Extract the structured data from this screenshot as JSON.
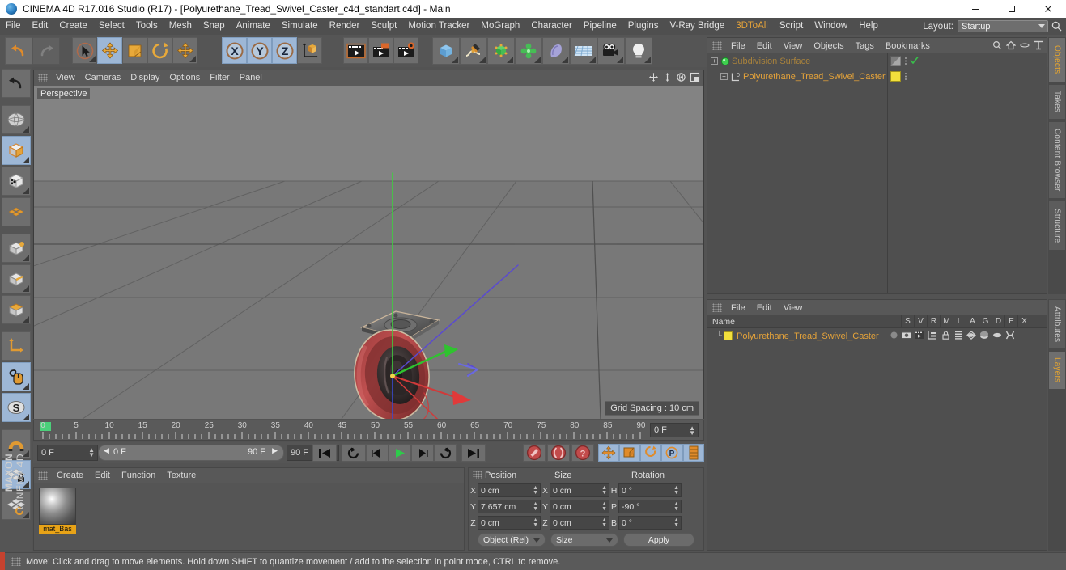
{
  "window": {
    "title": "CINEMA 4D R17.016 Studio (R17) - [Polyurethane_Tread_Swivel_Caster_c4d_standart.c4d] - Main",
    "minimize": "–",
    "maximize": "❐",
    "close": "✕"
  },
  "menubar": {
    "items": [
      "File",
      "Edit",
      "Create",
      "Select",
      "Tools",
      "Mesh",
      "Snap",
      "Animate",
      "Simulate",
      "Render",
      "Sculpt",
      "Motion Tracker",
      "MoGraph",
      "Character",
      "Pipeline",
      "Plugins",
      "V-Ray Bridge",
      "3DToAll",
      "Script",
      "Window",
      "Help"
    ],
    "layout_label": "Layout:",
    "layout_value": "Startup"
  },
  "toolbar": {
    "groups": [
      {
        "name": "undo-redo",
        "buttons": [
          {
            "name": "undo-button",
            "icon": "undo-icon",
            "selected": false
          },
          {
            "name": "redo-button",
            "icon": "redo-icon",
            "selected": false
          }
        ]
      },
      {
        "name": "selection-transform",
        "buttons": [
          {
            "name": "live-selection-tool",
            "icon": "cursor-select-icon",
            "selected": false
          },
          {
            "name": "move-tool",
            "icon": "move-icon",
            "selected": true
          },
          {
            "name": "scale-tool",
            "icon": "scale-icon",
            "selected": false
          },
          {
            "name": "rotate-tool",
            "icon": "rotate-icon",
            "selected": false
          },
          {
            "name": "move-alt-tool",
            "icon": "move-icon",
            "selected": false
          }
        ]
      },
      {
        "name": "axis-locks",
        "buttons": [
          {
            "name": "x-axis-lock",
            "icon": "x-axis-icon",
            "selected": true,
            "label": "X"
          },
          {
            "name": "y-axis-lock",
            "icon": "y-axis-icon",
            "selected": true,
            "label": "Y"
          },
          {
            "name": "z-axis-lock",
            "icon": "z-axis-icon",
            "selected": true,
            "label": "Z"
          },
          {
            "name": "world-object-coordinates",
            "icon": "world-axis-icon",
            "selected": false
          }
        ]
      },
      {
        "name": "render-group",
        "buttons": [
          {
            "name": "render-view-button",
            "icon": "render-view-icon",
            "selected": false
          },
          {
            "name": "render-region-button",
            "icon": "render-region-icon",
            "selected": false
          },
          {
            "name": "render-settings-button",
            "icon": "render-settings-icon",
            "selected": false
          }
        ]
      },
      {
        "name": "object-creation",
        "buttons": [
          {
            "name": "add-cube-button",
            "icon": "cube-icon",
            "selected": false
          },
          {
            "name": "add-spline-button",
            "icon": "pen-spline-icon",
            "selected": false
          },
          {
            "name": "nurbs-generator-button",
            "icon": "green-cube-icon",
            "selected": false
          },
          {
            "name": "array-modeling-button",
            "icon": "green-cluster-icon",
            "selected": false
          },
          {
            "name": "deformer-button",
            "icon": "bend-deformer-icon",
            "selected": false
          },
          {
            "name": "environment-button",
            "icon": "floor-sky-icon",
            "selected": false
          },
          {
            "name": "camera-button",
            "icon": "camera-icon",
            "selected": false
          },
          {
            "name": "light-button",
            "icon": "light-bulb-icon",
            "selected": false
          }
        ]
      }
    ]
  },
  "left_palette": {
    "items": [
      {
        "name": "tool-undo",
        "icon": "undo-arrow-icon",
        "selected": false
      },
      {
        "name": "tool-make-editable",
        "icon": "make-editable-icon",
        "selected": false
      },
      {
        "name": "tool-model-mode",
        "icon": "model-cube-icon",
        "selected": true
      },
      {
        "name": "tool-texture-mode",
        "icon": "texture-cube-icon",
        "selected": false
      },
      {
        "name": "tool-workplane",
        "icon": "workplane-grid-icon",
        "selected": false
      },
      {
        "name": "tool-point-mode",
        "icon": "point-mode-icon",
        "selected": false
      },
      {
        "name": "tool-edge-mode",
        "icon": "edge-mode-icon",
        "selected": false
      },
      {
        "name": "tool-polygon-mode",
        "icon": "polygon-mode-icon",
        "selected": false
      },
      {
        "name": "tool-axis-mode",
        "icon": "axis-mode-icon",
        "selected": false
      },
      {
        "name": "tool-viewport-solo",
        "icon": "mouse-icon",
        "selected": true
      },
      {
        "name": "tool-soft-selection",
        "icon": "s-circle-icon",
        "selected": true
      },
      {
        "name": "tool-snap-magnet",
        "icon": "magnet-icon",
        "selected": false
      },
      {
        "name": "tool-workplane-lock",
        "icon": "grid-lock-icon",
        "selected": true
      },
      {
        "name": "tool-planar-workplane",
        "icon": "grid-rotate-icon",
        "selected": false
      }
    ],
    "brand_line1": "MAXON",
    "brand_line2": "CINEMA 4D"
  },
  "viewport": {
    "menu": [
      "View",
      "Cameras",
      "Display",
      "Options",
      "Filter",
      "Panel"
    ],
    "view_label": "Perspective",
    "grid_spacing": "Grid Spacing : 10 cm",
    "corner_icons": [
      "pan-icon",
      "dolly-icon",
      "orbit-icon",
      "maximize-view-icon"
    ]
  },
  "timeline": {
    "ticks": [
      "0",
      "5",
      "10",
      "15",
      "20",
      "25",
      "30",
      "35",
      "40",
      "45",
      "50",
      "55",
      "60",
      "65",
      "70",
      "75",
      "80",
      "85",
      "90"
    ],
    "current_frame_field": "0 F"
  },
  "transport": {
    "current_frame": "0 F",
    "range_start": "0 F",
    "range_end": "90 F",
    "end_frame": "90 F",
    "buttons": [
      {
        "name": "go-to-start-button",
        "icon": "skip-start-icon"
      },
      {
        "name": "play-backwards-loop-button",
        "icon": "loop-icon"
      },
      {
        "name": "previous-key-button",
        "icon": "prev-key-icon"
      },
      {
        "name": "play-button",
        "icon": "play-icon"
      },
      {
        "name": "next-key-button",
        "icon": "next-key-icon"
      },
      {
        "name": "loop-playback-button",
        "icon": "loop-arrow-icon"
      },
      {
        "name": "go-to-end-button",
        "icon": "skip-end-icon"
      }
    ],
    "record_buttons": [
      {
        "name": "record-active-objects-button",
        "icon": "record-key-icon"
      },
      {
        "name": "autokeying-button",
        "icon": "autokey-icon"
      },
      {
        "name": "keyframe-selection-button",
        "icon": "question-key-icon"
      }
    ],
    "key_filter_buttons": [
      {
        "name": "position-key-toggle",
        "icon": "move-key-icon"
      },
      {
        "name": "scale-key-toggle",
        "icon": "scale-key-icon"
      },
      {
        "name": "rotation-key-toggle",
        "icon": "rotate-key-icon"
      },
      {
        "name": "parameter-key-toggle",
        "icon": "p-key-icon"
      },
      {
        "name": "point-level-animation-toggle",
        "icon": "pla-dots-icon"
      }
    ],
    "layers_button": {
      "name": "timeline-layers-button",
      "icon": "timeline-stack-icon"
    }
  },
  "material_manager": {
    "menu": [
      "Create",
      "Edit",
      "Function",
      "Texture"
    ],
    "materials": [
      {
        "name": "mat_Bas"
      }
    ]
  },
  "coordinate_manager": {
    "headers": [
      "Position",
      "Size",
      "Rotation"
    ],
    "rows": [
      {
        "pos_axis": "X",
        "pos_value": "0 cm",
        "size_axis": "X",
        "size_value": "0 cm",
        "rot_axis": "H",
        "rot_value": "0 °"
      },
      {
        "pos_axis": "Y",
        "pos_value": "7.657 cm",
        "size_axis": "Y",
        "size_value": "0 cm",
        "rot_axis": "P",
        "rot_value": "-90 °"
      },
      {
        "pos_axis": "Z",
        "pos_value": "0 cm",
        "size_axis": "Z",
        "size_value": "0 cm",
        "rot_axis": "B",
        "rot_value": "0 °"
      }
    ],
    "mode_dropdown": "Object (Rel)",
    "size_dropdown": "Size",
    "apply_button": "Apply"
  },
  "object_manager": {
    "menu": [
      "File",
      "Edit",
      "View",
      "Objects",
      "Tags",
      "Bookmarks"
    ],
    "header_icons": [
      "search-icon",
      "home-icon",
      "minus-icon",
      "fit-icon"
    ],
    "objects": [
      {
        "name": "Subdivision Surface",
        "depth": 0,
        "color": "dim",
        "icon": "subdivision-surface-icon",
        "tag": "display-tag",
        "check": true
      },
      {
        "name": "Polyurethane_Tread_Swivel_Caster",
        "depth": 1,
        "color": "bright",
        "icon": "null-object-icon",
        "tag": "material-tag",
        "check": false
      }
    ]
  },
  "layer_manager": {
    "menu": [
      "File",
      "Edit",
      "View"
    ],
    "columns": [
      "Name",
      "S",
      "V",
      "R",
      "M",
      "L",
      "A",
      "G",
      "D",
      "E",
      "X"
    ],
    "rows": [
      {
        "name": "Polyurethane_Tread_Swivel_Caster",
        "swatch": "#f2e03c"
      }
    ]
  },
  "right_tabs": {
    "top": [
      "Objects",
      "Takes",
      "Content Browser",
      "Structure"
    ],
    "top_active": "Objects",
    "bottom": [
      "Attributes",
      "Layers"
    ],
    "bottom_active": "Layers"
  },
  "statusbar": {
    "message": "Move: Click and drag to move elements. Hold down SHIFT to quantize movement / add to the selection in point mode, CTRL to remove."
  },
  "colors": {
    "accent_orange": "#e5a33a",
    "selected_blue": "#9db7d6",
    "panel_bg": "#535353",
    "field_bg": "#464646",
    "axis_x": "#d03a3a",
    "axis_y": "#3fd03f",
    "axis_z": "#3a4ad0",
    "material_yellow": "#f2e03c",
    "timeline_green": "#4bd07a"
  }
}
